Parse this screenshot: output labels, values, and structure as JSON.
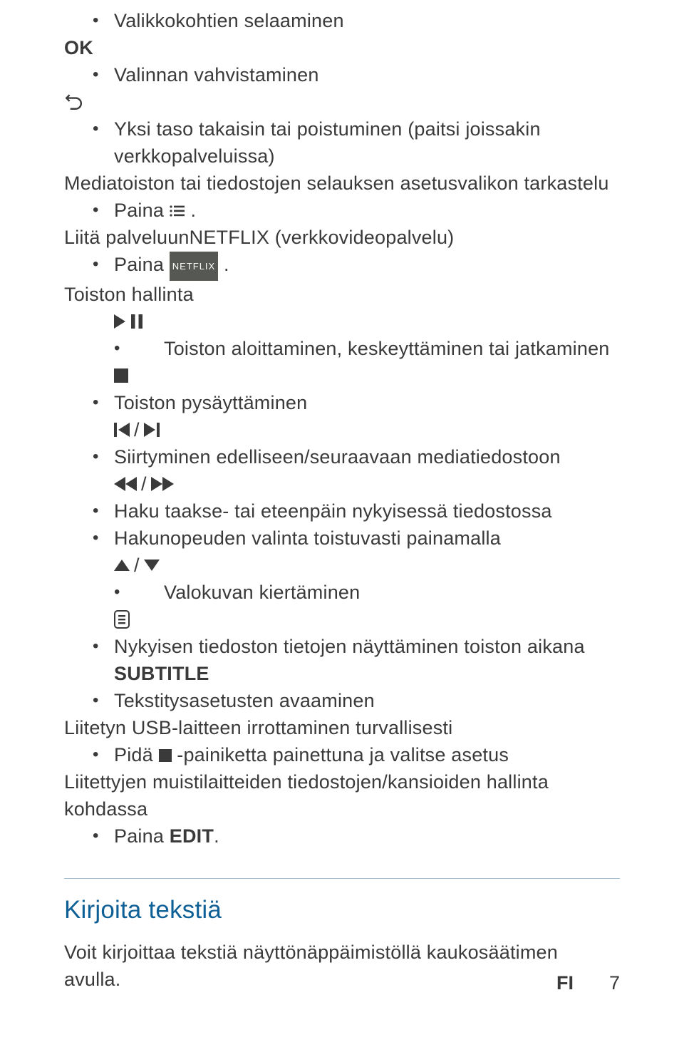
{
  "items": {
    "browse": "Valikkokohtien selaaminen",
    "ok_label": "OK",
    "confirm": "Valinnan vahvistaminen",
    "back_one": "Yksi taso takaisin tai poistuminen (paitsi joissakin verkkopalveluissa)",
    "media_settings": "Mediatoiston tai tiedostojen selauksen asetusvalikon tarkastelu",
    "press": "Paina ",
    "press_dot": ".",
    "netflix_heading_a": "Liitä palveluun",
    "netflix_heading_b": "NETFLIX",
    "netflix_heading_c": " (verkkovideopalvelu)",
    "netflix_badge": "NETFLIX",
    "playback_control": "Toiston hallinta",
    "play_pause": "Toiston aloittaminen, keskeyttäminen tai jatkaminen",
    "stop": "Toiston pysäyttäminen",
    "prev_next": "Siirtyminen edelliseen/seuraavaan mediatiedostoon",
    "seek": "Haku taakse- tai eteenpäin nykyisessä tiedostossa",
    "seek_speed": "Hakunopeuden valinta toistuvasti painamalla",
    "rotate": "Valokuvan kiertäminen",
    "info": "Nykyisen tiedoston tietojen näyttäminen toiston aikana",
    "subtitle_label": "SUBTITLE",
    "subtitle_action": "Tekstitysasetusten avaaminen",
    "usb_safe_remove": "Liitetyn USB-laitteen irrottaminen turvallisesti",
    "hold_a": "Pidä ",
    "hold_b": " -painiketta painettuna ja valitse asetus",
    "storage_manage": "Liitettyjen muistilaitteiden tiedostojen/kansioiden hallinta kohdassa",
    "edit_label": "EDIT",
    "edit_dot": "."
  },
  "section": {
    "title": "Kirjoita tekstiä",
    "body": "Voit kirjoittaa tekstiä näyttönäppäimistöllä kaukosäätimen avulla."
  },
  "footer": {
    "lang": "FI",
    "page": "7"
  }
}
